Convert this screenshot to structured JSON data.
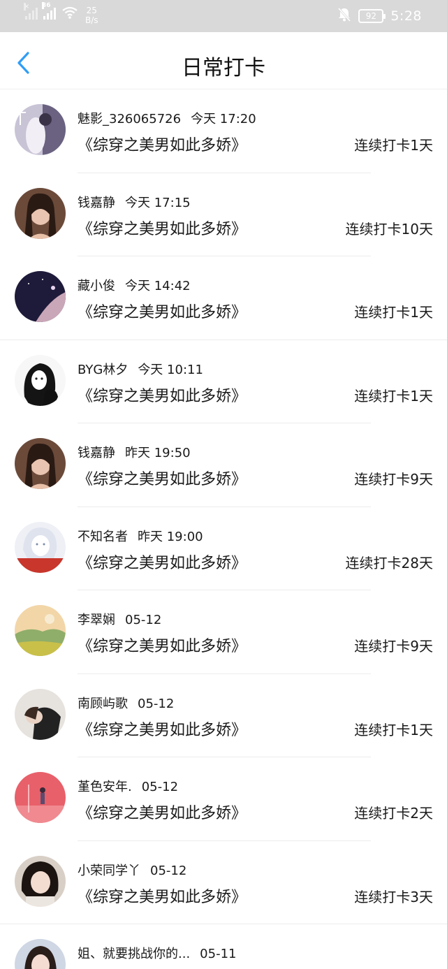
{
  "status_bar": {
    "net_speed_value": "25",
    "net_speed_unit": "B/s",
    "signal_label": "36",
    "battery": "92",
    "time": "5:28"
  },
  "nav": {
    "title": "日常打卡",
    "back_icon": "chevron-left-icon"
  },
  "colors": {
    "accent": "#2f9df7",
    "status_bar_bg": "#d9d9d9",
    "divider": "#ececec"
  },
  "checkins": [
    {
      "user": "魅影_326065726",
      "time": "今天 17:20",
      "book": "《综穿之美男如此多娇》",
      "streak": "连续打卡1天"
    },
    {
      "user": "钱嘉静",
      "time": "今天 17:15",
      "book": "《综穿之美男如此多娇》",
      "streak": "连续打卡10天"
    },
    {
      "user": "藏小俊",
      "time": "今天 14:42",
      "book": "《综穿之美男如此多娇》",
      "streak": "连续打卡1天"
    },
    {
      "user": "BYG林夕",
      "time": "今天 10:11",
      "book": "《综穿之美男如此多娇》",
      "streak": "连续打卡1天"
    },
    {
      "user": "钱嘉静",
      "time": "昨天 19:50",
      "book": "《综穿之美男如此多娇》",
      "streak": "连续打卡9天"
    },
    {
      "user": "不知名者",
      "time": "昨天 19:00",
      "book": "《综穿之美男如此多娇》",
      "streak": "连续打卡28天"
    },
    {
      "user": "李翠娴",
      "time": "05-12",
      "book": "《综穿之美男如此多娇》",
      "streak": "连续打卡9天"
    },
    {
      "user": "南顾屿歌",
      "time": "05-12",
      "book": "《综穿之美男如此多娇》",
      "streak": "连续打卡1天"
    },
    {
      "user": "堇色安年.",
      "time": "05-12",
      "book": "《综穿之美男如此多娇》",
      "streak": "连续打卡2天"
    },
    {
      "user": "小荣同学丫",
      "time": "05-12",
      "book": "《综穿之美男如此多娇》",
      "streak": "连续打卡3天"
    },
    {
      "user": "姐、就要挑战你的...",
      "time": "05-11",
      "book": "",
      "streak": ""
    }
  ]
}
